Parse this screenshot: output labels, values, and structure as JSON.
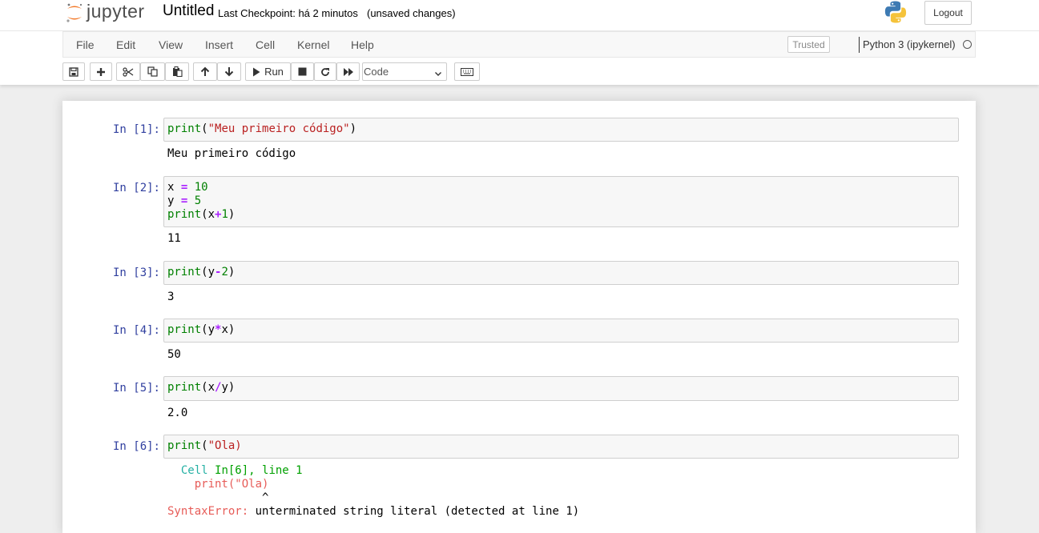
{
  "header": {
    "logo_text": "jupyter",
    "notebook_name": "Untitled",
    "checkpoint": "Last Checkpoint: há 2 minutos",
    "autosave_status": "(unsaved changes)",
    "logout_label": "Logout"
  },
  "menubar": {
    "items": [
      "File",
      "Edit",
      "View",
      "Insert",
      "Cell",
      "Kernel",
      "Help"
    ],
    "trusted_label": "Trusted",
    "kernel_name": "Python 3 (ipykernel)"
  },
  "toolbar": {
    "run_label": "Run",
    "cell_type": "Code",
    "buttons": [
      "save-icon",
      "plus-icon",
      "cut-icon",
      "copy-icon",
      "paste-icon",
      "arrow-up-icon",
      "arrow-down-icon",
      "run-icon",
      "stop-icon",
      "restart-icon",
      "fast-forward-icon",
      "keyboard-icon"
    ]
  },
  "cells": [
    {
      "prompt": "In [1]:",
      "code": [
        "print(\"Meu primeiro código\")"
      ],
      "output": "Meu primeiro código"
    },
    {
      "prompt": "In [2]:",
      "code": [
        "x = 10",
        "y = 5",
        "print(x+1)"
      ],
      "output": "11"
    },
    {
      "prompt": "In [3]:",
      "code": [
        "print(y-2)"
      ],
      "output": "3"
    },
    {
      "prompt": "In [4]:",
      "code": [
        "print(y*x)"
      ],
      "output": "50"
    },
    {
      "prompt": "In [5]:",
      "code": [
        "print(x/y)"
      ],
      "output": "2.0"
    },
    {
      "prompt": "In [6]:",
      "code": [
        "print(\"Ola)"
      ],
      "error": {
        "cell_word": "Cell",
        "cell_ref": "In[6], line 1",
        "code_line": "print(\"Ola)",
        "caret": "^",
        "error_type": "SyntaxError:",
        "error_message": "unterminated string literal (detected at line 1)"
      }
    }
  ],
  "colors": {
    "prompt": "#303f9f",
    "builtin": "#008000",
    "string": "#ba2121",
    "operator": "#aa22ff",
    "error_red": "#e75c58",
    "background": "#eeeeee"
  }
}
